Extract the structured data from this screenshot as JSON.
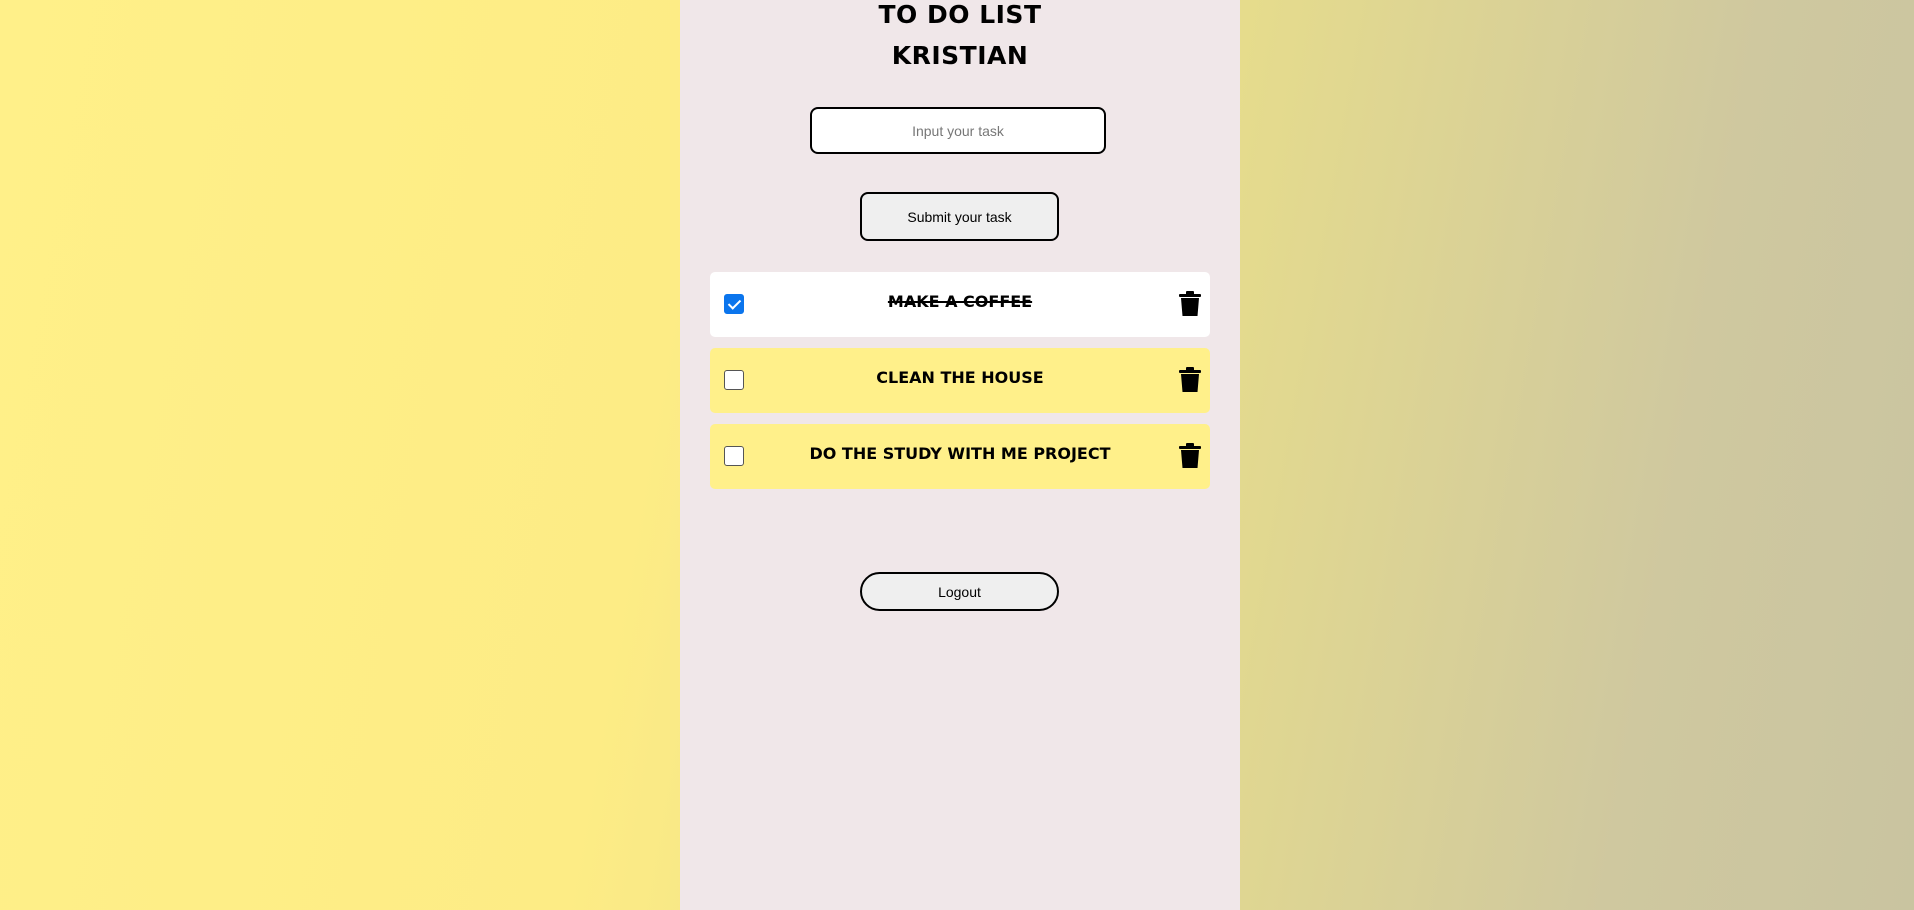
{
  "header": {
    "title": "TO DO LIST",
    "user_name": "KRISTIAN"
  },
  "task_form": {
    "input_placeholder": "Input your task",
    "input_value": "",
    "submit_label": "Submit your task"
  },
  "tasks": [
    {
      "label": "Make a coffee",
      "completed": true
    },
    {
      "label": "Clean the house",
      "completed": false
    },
    {
      "label": "Do the study with me project",
      "completed": false
    }
  ],
  "logout_label": "Logout",
  "icons": {
    "delete": "trash-icon",
    "checkbox": "checkbox"
  },
  "colors": {
    "panel": "#f0e7e9",
    "task_pending": "#fff08a",
    "task_done": "#ffffff",
    "checkbox_accent": "#0b75ed"
  }
}
